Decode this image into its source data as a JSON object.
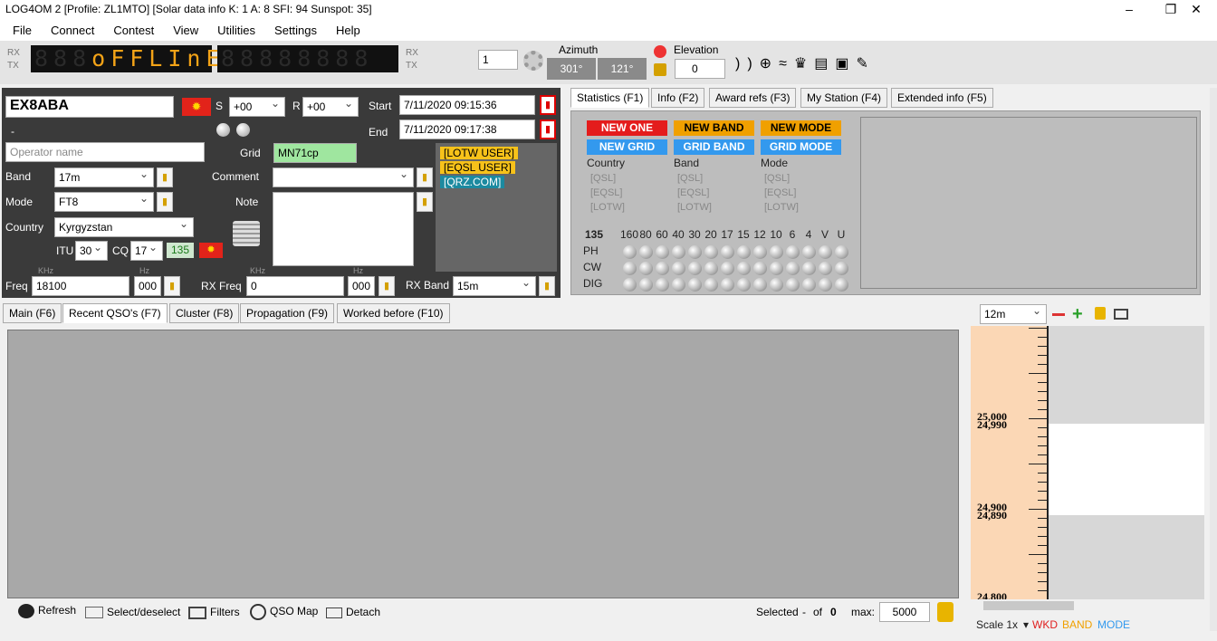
{
  "window": {
    "title": "LOG4OM 2 [Profile: ZL1MTO] [Solar data info K: 1 A: 8 SFI: 94 Sunspot: 35]",
    "min": "–",
    "max": "❐",
    "close": "✕"
  },
  "menu": [
    "File",
    "Connect",
    "Contest",
    "View",
    "Utilities",
    "Settings",
    "Help"
  ],
  "toolbar": {
    "rx": "RX",
    "tx": "TX",
    "display_dim1": "888",
    "display_lit": "oFFLInE",
    "display_dim2": "88888888",
    "radio_num": "1",
    "azimuth_label": "Azimuth",
    "az1": "301°",
    "az2": "121°",
    "elevation_label": "Elevation",
    "elevation_value": "0"
  },
  "qso": {
    "callsign": "EX8ABA",
    "s_label": "S",
    "s_value": "+00",
    "r_label": "R",
    "r_value": "+00",
    "start_label": "Start",
    "start_value": "7/11/2020 09:15:36",
    "end_label": "End",
    "end_value": "7/11/2020 09:17:38",
    "dash": "-",
    "operator_placeholder": "Operator name",
    "grid_label": "Grid",
    "grid_value": "MN71cp",
    "band_label": "Band",
    "band_value": "17m",
    "mode_label": "Mode",
    "mode_value": "FT8",
    "country_label": "Country",
    "country_value": "Kyrgyzstan",
    "itu_label": "ITU",
    "itu_value": "30",
    "cq_label": "CQ",
    "cq_value": "17",
    "dxcc": "135",
    "comment_label": "Comment",
    "note_label": "Note",
    "lotw": "[LOTW USER]",
    "eqsl": "[EQSL USER]",
    "qrz": "[QRZ.COM]",
    "khz": "KHz",
    "hz": "Hz",
    "freq_label": "Freq",
    "freq_value": "18100",
    "freq_hz": "000",
    "rxfreq_label": "RX Freq",
    "rxfreq_value": "0",
    "rxfreq_hz": "000",
    "rxband_label": "RX Band",
    "rxband_value": "15m"
  },
  "info_tabs": [
    "Statistics (F1)",
    "Info (F2)",
    "Award refs (F3)",
    "My Station (F4)",
    "Extended info (F5)"
  ],
  "stats": {
    "new_one": "NEW ONE",
    "new_band": "NEW BAND",
    "new_mode": "NEW MODE",
    "new_grid": "NEW GRID",
    "grid_band": "GRID BAND",
    "grid_mode": "GRID MODE",
    "cols": [
      "Country",
      "Band",
      "Mode"
    ],
    "qsl": "[QSL]",
    "eqsl": "[EQSL]",
    "lotw": "[LOTW]",
    "dxcc": "135",
    "bands": [
      "160",
      "80",
      "60",
      "40",
      "30",
      "20",
      "17",
      "15",
      "12",
      "10",
      "6",
      "4",
      "V",
      "U"
    ],
    "modes": [
      "PH",
      "CW",
      "DIG"
    ],
    "colors": {
      "red": "#e41c1c",
      "orange": "#f0a000",
      "blue": "#3399ee"
    }
  },
  "main_tabs": [
    "Main (F6)",
    "Recent QSO's (F7)",
    "Cluster (F8)",
    "Propagation (F9)",
    "Worked before (F10)"
  ],
  "bottom": {
    "refresh": "Refresh",
    "select": "Select/deselect",
    "filters": "Filters",
    "qsomap": "QSO Map",
    "detach": "Detach",
    "selected_label": "Selected",
    "selected_dash": "-",
    "of_label": "of",
    "of_value": "0",
    "max_label": "max:",
    "max_value": "5000"
  },
  "bandmap": {
    "band": "12m",
    "scale": "Scale 1x",
    "wkd": "WKD",
    "band_lbl": "BAND",
    "mode_lbl": "MODE",
    "freqs": [
      "25,000",
      "24,990",
      "24,900",
      "24,890",
      "24,800"
    ]
  }
}
